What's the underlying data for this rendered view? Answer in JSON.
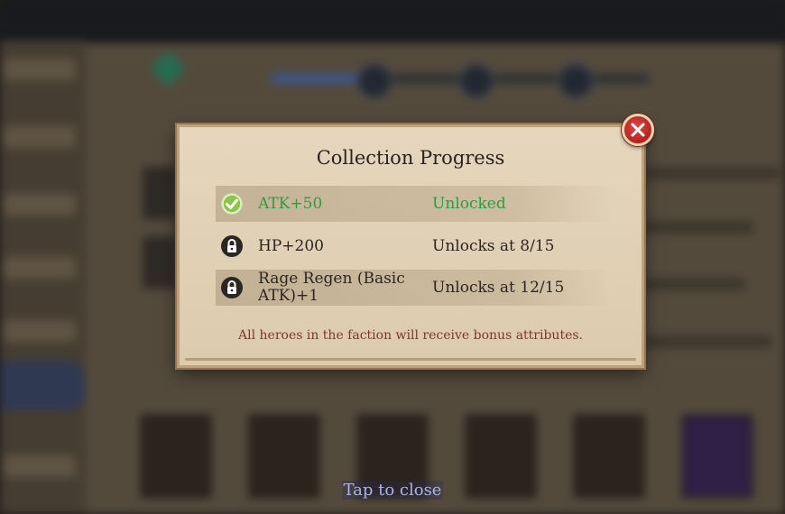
{
  "dialog": {
    "title": "Collection Progress",
    "rows": [
      {
        "label": "ATK+50",
        "status": "Unlocked",
        "icon": "check-badge-icon",
        "unlocked": true
      },
      {
        "label": "HP+200",
        "status": "Unlocks at 8/15",
        "icon": "lock-icon",
        "unlocked": false
      },
      {
        "label": "Rage Regen (Basic ATK)+1",
        "status": "Unlocks at 12/15",
        "icon": "lock-icon",
        "unlocked": false
      }
    ],
    "footnote": "All heroes in the faction will receive bonus attributes.",
    "close_icon": "close-icon"
  },
  "hint": {
    "tap_to_close": "Tap to close"
  },
  "colors": {
    "unlocked_text": "#2f9c3f",
    "footnote_text": "#7a3a2a",
    "close_button": "#c8302a",
    "dialog_bg": "#e2d3b8"
  }
}
